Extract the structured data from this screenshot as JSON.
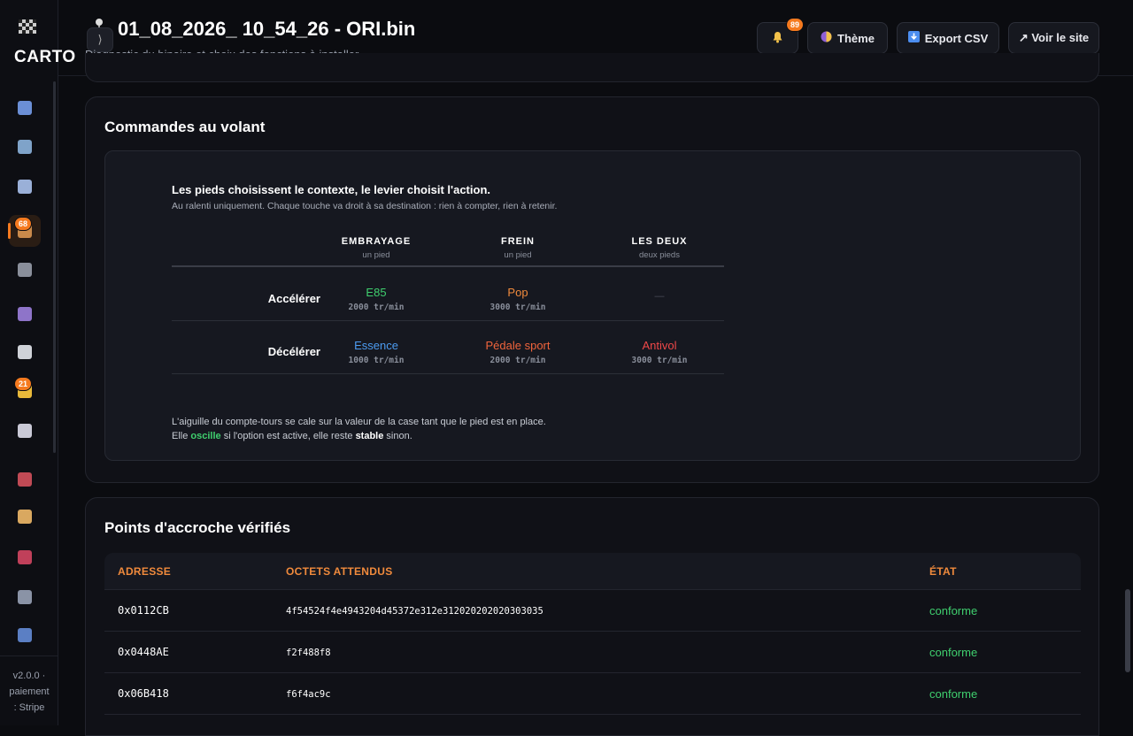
{
  "sidebar": {
    "logo_text": "CARTO",
    "logo_icon": "checkered-flag-icon",
    "items": [
      {
        "name": "dashboard-icon",
        "color": "#6b8fd6"
      },
      {
        "name": "tv-icon",
        "color": "#7fa3c9"
      },
      {
        "name": "chart-icon",
        "color": "#9ab0d8"
      },
      {
        "name": "package-icon",
        "color": "#c98a4b",
        "badge": "68",
        "active": true
      },
      {
        "name": "plug-icon",
        "color": "#8a8f9b"
      },
      {
        "name": "users-icon",
        "color": "#8e74c9"
      },
      {
        "name": "chat-icon",
        "color": "#cfd2d8"
      },
      {
        "name": "star-icon",
        "color": "#e8b93a",
        "badge": "21"
      },
      {
        "name": "robot-icon",
        "color": "#c9c9d6"
      },
      {
        "name": "car-icon",
        "color": "#c04a55"
      },
      {
        "name": "tag-icon",
        "color": "#d9a860"
      },
      {
        "name": "ticket-icon",
        "color": "#c0405a"
      },
      {
        "name": "building-icon",
        "color": "#8a93a6"
      },
      {
        "name": "shield-icon",
        "color": "#5b7fc4"
      }
    ],
    "footer_line1": "v2.0.0 ·",
    "footer_line2": "paiement",
    "footer_line3": ": Stripe"
  },
  "header": {
    "title": "01_08_2026_ 10_54_26 - ORI.bin",
    "subtitle": "Diagnostic du binaire et choix des fonctions à installer.",
    "notification_count": "89",
    "theme_label": "Thème",
    "export_label": "Export CSV",
    "site_label": "↗ Voir le site"
  },
  "steering": {
    "title": "Commandes au volant",
    "lead": "Les pieds choisissent le contexte, le levier choisit l'action.",
    "lead_sub": "Au ralenti uniquement. Chaque touche va droit à sa destination : rien à compter, rien à retenir.",
    "columns": [
      {
        "label": "EMBRAYAGE",
        "sub": "un pied"
      },
      {
        "label": "FREIN",
        "sub": "un pied"
      },
      {
        "label": "LES DEUX",
        "sub": "deux pieds"
      }
    ],
    "rows": [
      {
        "label": "Accélérer",
        "cells": [
          {
            "value": "E85",
            "rpm": "2000 tr/min",
            "color": "#3fcf6e"
          },
          {
            "value": "Pop",
            "rpm": "3000 tr/min",
            "color": "#f08a3c"
          },
          {
            "value": "—",
            "rpm": "",
            "color": "#4a4d57"
          }
        ]
      },
      {
        "label": "Décélérer",
        "cells": [
          {
            "value": "Essence",
            "rpm": "1000 tr/min",
            "color": "#4c9bf0"
          },
          {
            "value": "Pédale sport",
            "rpm": "2000 tr/min",
            "color": "#f0643c"
          },
          {
            "value": "Antivol",
            "rpm": "3000 tr/min",
            "color": "#f04848"
          }
        ]
      }
    ],
    "foot1": "L'aiguille du compte-tours se cale sur la valeur de la case tant que le pied est en place.",
    "foot2_a": "Elle ",
    "foot2_b": "oscille",
    "foot2_c": " si l'option est active, elle reste ",
    "foot2_d": "stable",
    "foot2_e": " sinon."
  },
  "hooks": {
    "title": "Points d'accroche vérifiés",
    "headers": [
      "ADRESSE",
      "OCTETS ATTENDUS",
      "ÉTAT"
    ],
    "rows": [
      {
        "addr": "0x0112CB",
        "bytes": "4f54524f4e4943204d45372e312e312020202020303035",
        "state": "conforme"
      },
      {
        "addr": "0x0448AE",
        "bytes": "f2f488f8",
        "state": "conforme"
      },
      {
        "addr": "0x06B418",
        "bytes": "f6f4ac9c",
        "state": "conforme"
      }
    ]
  },
  "colors": {
    "accent": "#f57a1f",
    "ok": "#3fcf6e"
  }
}
